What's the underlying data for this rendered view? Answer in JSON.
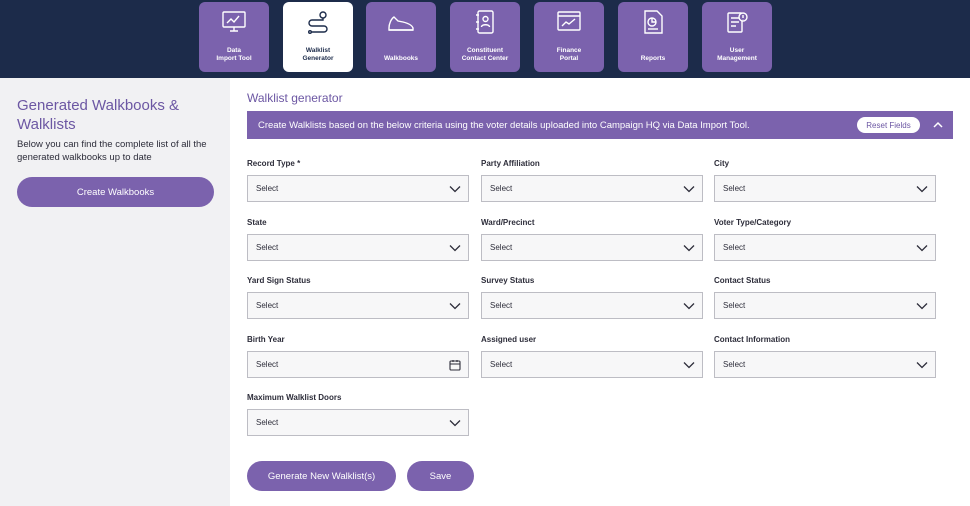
{
  "nav": {
    "tiles": [
      {
        "label": "Data\nImport Tool",
        "icon": "data-import-icon"
      },
      {
        "label": "Walklist\nGenerator",
        "icon": "walklist-route-icon"
      },
      {
        "label": "Walkbooks",
        "icon": "shoe-icon"
      },
      {
        "label": "Constituent\nContact Center",
        "icon": "contact-book-icon"
      },
      {
        "label": "Finance\nPortal",
        "icon": "finance-chart-icon"
      },
      {
        "label": "Reports",
        "icon": "report-icon"
      },
      {
        "label": "User\nManagement",
        "icon": "user-management-icon"
      }
    ],
    "active_index": 1
  },
  "sidebar": {
    "title": "Generated Walkbooks & Walklists",
    "description": "Below you can find the complete list of all the generated walkbooks up to date",
    "create_button": "Create Walkbooks"
  },
  "main": {
    "title": "Walklist generator",
    "banner_text": "Create Walklists based on the below criteria using the voter details uploaded into Campaign HQ via Data Import Tool.",
    "reset_button": "Reset Fields",
    "fields": [
      {
        "label": "Record Type *",
        "value": "Select",
        "control": "dropdown"
      },
      {
        "label": "Party Affiliation",
        "value": "Select",
        "control": "dropdown"
      },
      {
        "label": "City",
        "value": "Select",
        "control": "dropdown"
      },
      {
        "label": "State",
        "value": "Select",
        "control": "dropdown"
      },
      {
        "label": "Ward/Precinct",
        "value": "Select",
        "control": "dropdown"
      },
      {
        "label": "Voter Type/Category",
        "value": "Select",
        "control": "dropdown"
      },
      {
        "label": "Yard Sign Status",
        "value": "Select",
        "control": "dropdown"
      },
      {
        "label": "Survey Status",
        "value": "Select",
        "control": "dropdown"
      },
      {
        "label": "Contact Status",
        "value": "Select",
        "control": "dropdown"
      },
      {
        "label": "Birth Year",
        "value": "Select",
        "control": "date"
      },
      {
        "label": "Assigned user",
        "value": "Select",
        "control": "dropdown"
      },
      {
        "label": "Contact Information",
        "value": "Select",
        "control": "dropdown"
      },
      {
        "label": "Maximum Walklist Doors",
        "value": "Select",
        "control": "dropdown"
      }
    ],
    "generate_button": "Generate New Walklist(s)",
    "save_button": "Save"
  },
  "colors": {
    "nav_bg": "#1c2b4a",
    "accent": "#7b62ad",
    "sidebar_bg": "#f1f1f3"
  }
}
